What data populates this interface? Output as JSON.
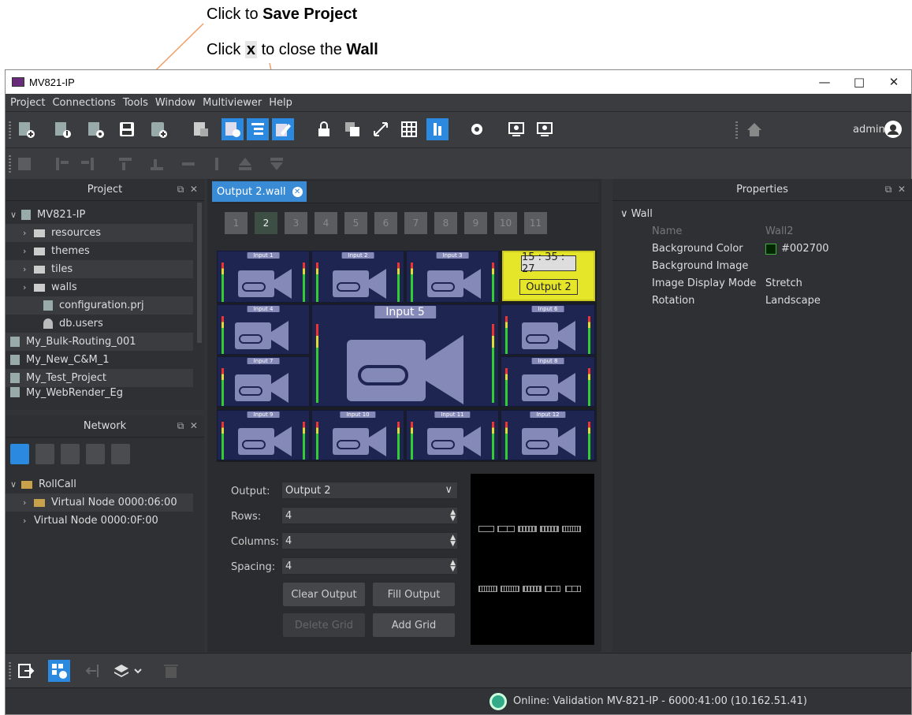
{
  "annotations": {
    "save_prefix": "Click to ",
    "save_bold": "Save Project",
    "close_prefix": "Click ",
    "close_key": "x",
    "close_mid": " to close the ",
    "close_bold": "Wall"
  },
  "window": {
    "title": "MV821-IP",
    "min": "—",
    "max": "□",
    "close": "✕"
  },
  "menu": [
    "Project",
    "Connections",
    "Tools",
    "Window",
    "Multiviewer",
    "Help"
  ],
  "toolbar": {
    "user": "admin"
  },
  "project_panel": {
    "title": "Project",
    "root": "MV821-IP",
    "items": [
      {
        "label": "resources",
        "type": "folder"
      },
      {
        "label": "themes",
        "type": "folder"
      },
      {
        "label": "tiles",
        "type": "folder"
      },
      {
        "label": "walls",
        "type": "folder"
      },
      {
        "label": "configuration.prj",
        "type": "file"
      },
      {
        "label": "db.users",
        "type": "file"
      }
    ],
    "projects": [
      "My_Bulk-Routing_001",
      "My_New_C&M_1",
      "My_Test_Project",
      "My_WebRender_Eg"
    ]
  },
  "network_panel": {
    "title": "Network",
    "root": "RollCall",
    "nodes": [
      "Virtual Node 0000:06:00",
      "Virtual Node 0000:0F:00"
    ]
  },
  "editor": {
    "tab_label": "Output 2.wall",
    "tab_close": "✕",
    "grid_numbers": [
      "1",
      "2",
      "3",
      "4",
      "5",
      "6",
      "7",
      "8",
      "9",
      "10",
      "11"
    ],
    "selected_grid": "2",
    "tiles": {
      "t1": "Input 1",
      "t2": "Input 2",
      "t3": "Input 3",
      "t4": "Input 4",
      "t5": "Input 5",
      "t6": "Input 6",
      "t7": "Input 7",
      "t8": "Input 8",
      "t9": "Input 9",
      "t10": "Input 10",
      "t11": "Input 11",
      "t12": "Input 12"
    },
    "clock": "15 : 35 : 27",
    "output_tile_label": "Output 2"
  },
  "form": {
    "output_label": "Output:",
    "output_value": "Output 2",
    "rows_label": "Rows:",
    "rows_value": "4",
    "columns_label": "Columns:",
    "columns_value": "4",
    "spacing_label": "Spacing:",
    "spacing_value": "4",
    "clear_output": "Clear Output",
    "fill_output": "Fill Output",
    "delete_grid": "Delete Grid",
    "add_grid": "Add Grid"
  },
  "properties": {
    "title": "Properties",
    "section": "Wall",
    "rows": [
      {
        "k": "Name",
        "v": "Wall2"
      },
      {
        "k": "Background Color",
        "v": "#002700"
      },
      {
        "k": "Background Image",
        "v": ""
      },
      {
        "k": "Image Display Mode",
        "v": "Stretch"
      },
      {
        "k": "Rotation",
        "v": "Landscape"
      }
    ],
    "bg_swatch_color": "#002700"
  },
  "status": {
    "text": "Online: Validation MV-821-IP - 6000:41:00 (10.162.51.41)"
  },
  "colors": {
    "accent": "#3a8bd6",
    "output_tile": "#e5e52a",
    "tile": "#1e2550"
  }
}
